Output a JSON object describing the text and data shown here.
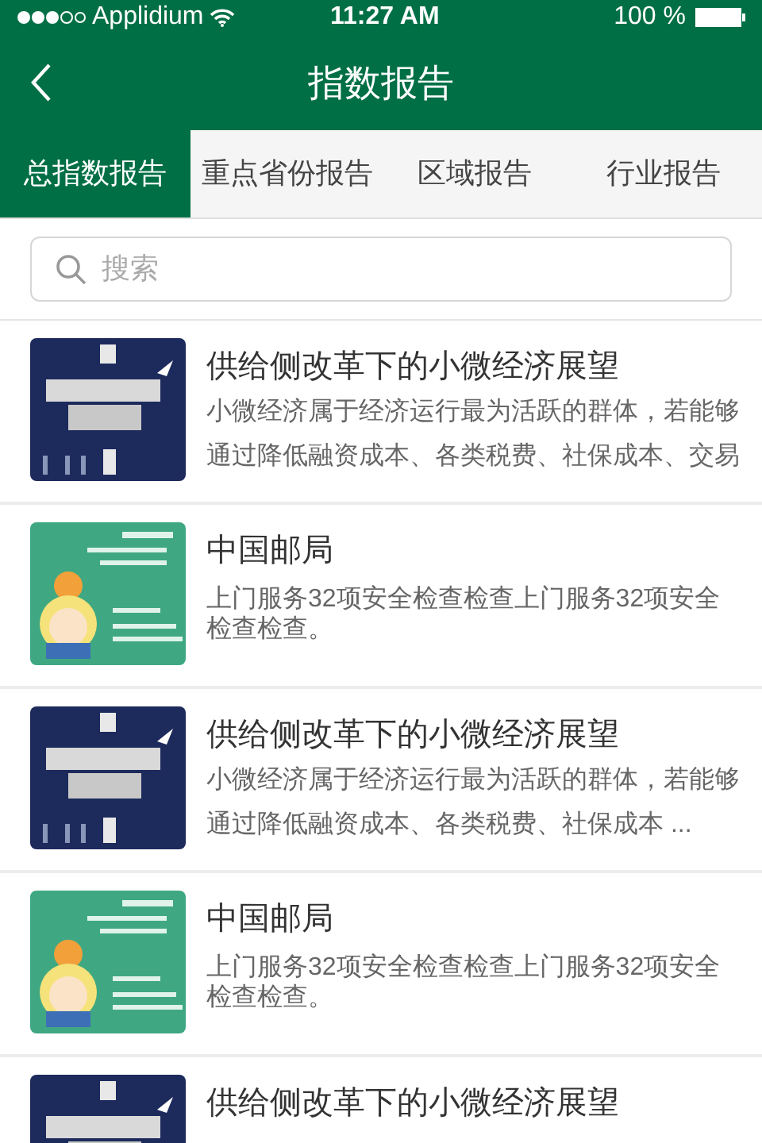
{
  "status_bar": {
    "carrier": "Applidium",
    "time": "11:27 AM",
    "battery": "100 %"
  },
  "nav": {
    "title": "指数报告"
  },
  "tabs": [
    {
      "label": "总指数报告",
      "selected": true
    },
    {
      "label": "重点省份报告",
      "selected": false
    },
    {
      "label": "区域报告",
      "selected": false
    },
    {
      "label": "行业报告",
      "selected": false
    }
  ],
  "search": {
    "placeholder": "搜索"
  },
  "items": [
    {
      "kind": "thanks",
      "title": "供给侧改革下的小微经济展望",
      "lines": [
        "小微经济属于经济运行最为活跃的群体，若能够",
        "通过降低融资成本、各类税费、社保成本、交易"
      ]
    },
    {
      "kind": "postal",
      "title": "中国邮局",
      "lines": [
        "上门服务32项安全检查检查上门服务32项安全",
        "检查检查。"
      ]
    },
    {
      "kind": "thanks",
      "title": "供给侧改革下的小微经济展望",
      "lines": [
        "小微经济属于经济运行最为活跃的群体，若能够",
        "通过降低融资成本、各类税费、社保成本 ..."
      ]
    },
    {
      "kind": "postal",
      "title": "中国邮局",
      "lines": [
        "上门服务32项安全检查检查上门服务32项安全",
        "检查检查。"
      ]
    },
    {
      "kind": "thanks",
      "title": "供给侧改革下的小微经济展望"
    }
  ]
}
